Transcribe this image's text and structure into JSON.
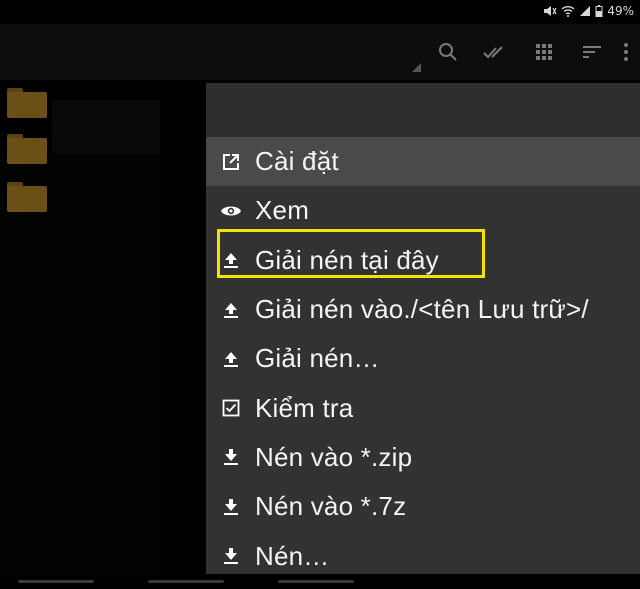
{
  "status_bar": {
    "battery": "49%",
    "icons": [
      "mute-icon",
      "wifi-icon",
      "signal-icon",
      "battery-icon"
    ]
  },
  "toolbar": {
    "icons": [
      "search-icon",
      "select-all-icon",
      "grid-view-icon",
      "sort-icon",
      "more-icon"
    ]
  },
  "menu": {
    "items": [
      {
        "label": "Cài đặt",
        "icon": "open-external-icon",
        "selected": true
      },
      {
        "label": "Xem",
        "icon": "eye-icon",
        "selected": false
      },
      {
        "label": "Giải nén tại đây",
        "icon": "extract-icon",
        "selected": false,
        "highlighted": true
      },
      {
        "label": "Giải nén vào./<tên Lưu trữ>/",
        "icon": "extract-icon",
        "selected": false
      },
      {
        "label": "Giải nén…",
        "icon": "extract-icon",
        "selected": false
      },
      {
        "label": "Kiểm tra",
        "icon": "checkbox-icon",
        "selected": false
      },
      {
        "label": "Nén vào *.zip",
        "icon": "compress-icon",
        "selected": false
      },
      {
        "label": "Nén vào *.7z",
        "icon": "compress-icon",
        "selected": false
      },
      {
        "label": "Nén…",
        "icon": "compress-icon",
        "selected": false
      }
    ]
  },
  "colors": {
    "menu_bg": "#323232",
    "selected_bg": "#4a4a4a",
    "highlight": "#f2e400",
    "folder": "#6b4f17"
  }
}
